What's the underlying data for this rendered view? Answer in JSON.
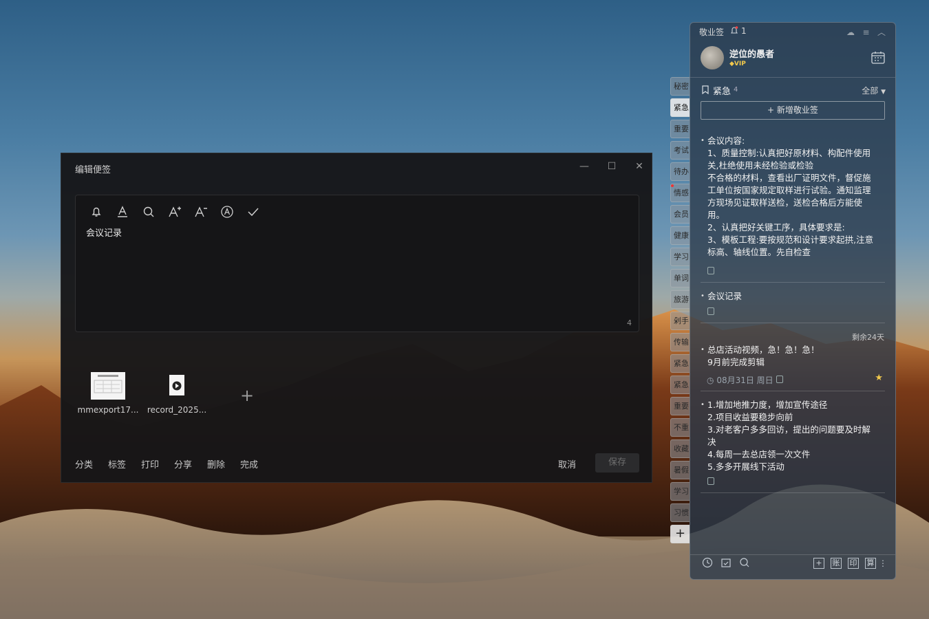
{
  "editor": {
    "title": "编辑便签",
    "content": "会议记录",
    "char_count": "4",
    "attachments": [
      {
        "name": "mmexport17..."
      },
      {
        "name": "record_2025..."
      }
    ],
    "bottom_actions": [
      "分类",
      "标签",
      "打印",
      "分享",
      "删除",
      "完成"
    ],
    "cancel_label": "取消",
    "save_label": "保存"
  },
  "side_tabs": [
    "秘密",
    "紧急",
    "重要",
    "考试",
    "待办",
    "情感",
    "会员",
    "健康",
    "学习",
    "单词",
    "旅游",
    "剁手",
    "传输",
    "紧急",
    "紧急",
    "重要",
    "不重",
    "收藏",
    "暑假",
    "学习",
    "习惯"
  ],
  "panel": {
    "app_title": "敬业签",
    "notification_count": "1",
    "user_name": "逆位的愚者",
    "vip_label": "VIP",
    "category": "紧急",
    "category_count": "4",
    "filter_label": "全部",
    "new_note_label": "新增敬业签",
    "notes": [
      {
        "lines": [
          "会议内容:",
          "1、质量控制:认真把好原材料、构配件使用",
          "关,杜绝使用未经检验或检验",
          "不合格的材料，查看出厂证明文件，督促施",
          "工单位按国家规定取样进行试验。通知监理",
          "方现场见证取样送检，送检合格后方能使",
          "用。",
          "2、认真把好关键工序，具体要求是:",
          "3、模板工程:要按规范和设计要求起拱,注意",
          "标高、轴线位置。先自检查"
        ]
      },
      {
        "lines": [
          "会议记录"
        ]
      },
      {
        "remaining": "剩余24天",
        "lines": [
          "总店活动视频，急！急！急！",
          "9月前完成剪辑"
        ],
        "date": "08月31日 周日"
      },
      {
        "lines": [
          "1.增加地推力度，增加宣传途径",
          "2.项目收益要稳步向前",
          "3.对老客户多多回访，提出的问题要及时解",
          "决",
          "4.每周一去总店领一次文件",
          "5.多多开展线下活动"
        ]
      }
    ],
    "footer_buttons": [
      "账",
      "印",
      "算"
    ]
  }
}
